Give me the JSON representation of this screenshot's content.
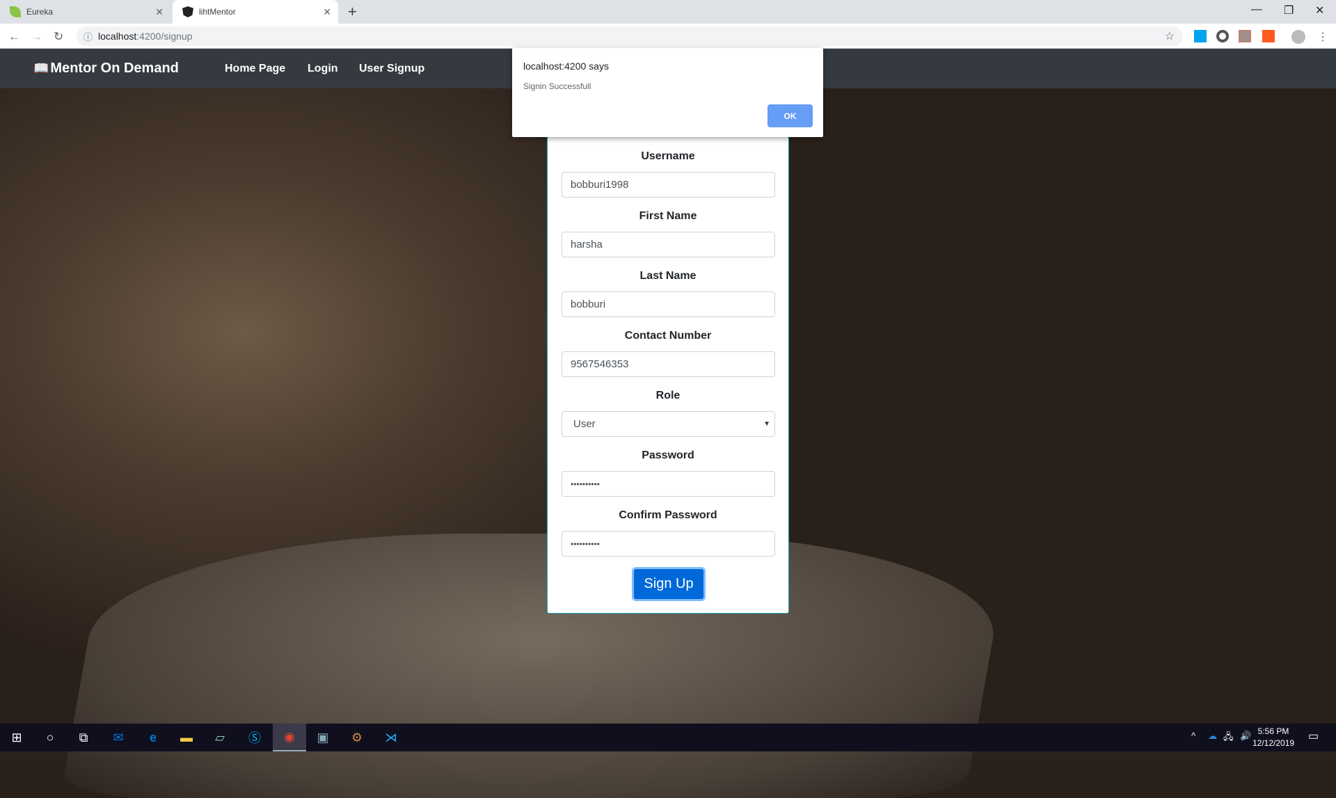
{
  "browser": {
    "tabs": [
      {
        "title": "Eureka",
        "icon": "spring-leaf-icon"
      },
      {
        "title": "lihtMentor",
        "icon": "angular-icon",
        "active": true
      }
    ],
    "url_host": "localhost",
    "url_path": ":4200/signup"
  },
  "navbar": {
    "brand": "Mentor On Demand",
    "links": [
      "Home Page",
      "Login",
      "User Signup"
    ]
  },
  "form": {
    "fields": [
      {
        "label": "Username",
        "value": "bobburi1998"
      },
      {
        "label": "First Name",
        "value": "harsha"
      },
      {
        "label": "Last Name",
        "value": "bobburi"
      },
      {
        "label": "Contact Number",
        "value": "9567546353"
      },
      {
        "label": "Role",
        "value": "User"
      },
      {
        "label": "Password",
        "value": "••••••••••"
      },
      {
        "label": "Confirm Password",
        "value": "••••••••••"
      }
    ],
    "submit": "Sign Up"
  },
  "dialog": {
    "title": "localhost:4200 says",
    "message": "Signin Successfull",
    "ok": "OK"
  },
  "taskbar": {
    "time": "5:56 PM",
    "date": "12/12/2019"
  },
  "colors": {
    "navbar": "#343a40",
    "primary": "#0069d9",
    "dialog_ok": "#669df6"
  }
}
